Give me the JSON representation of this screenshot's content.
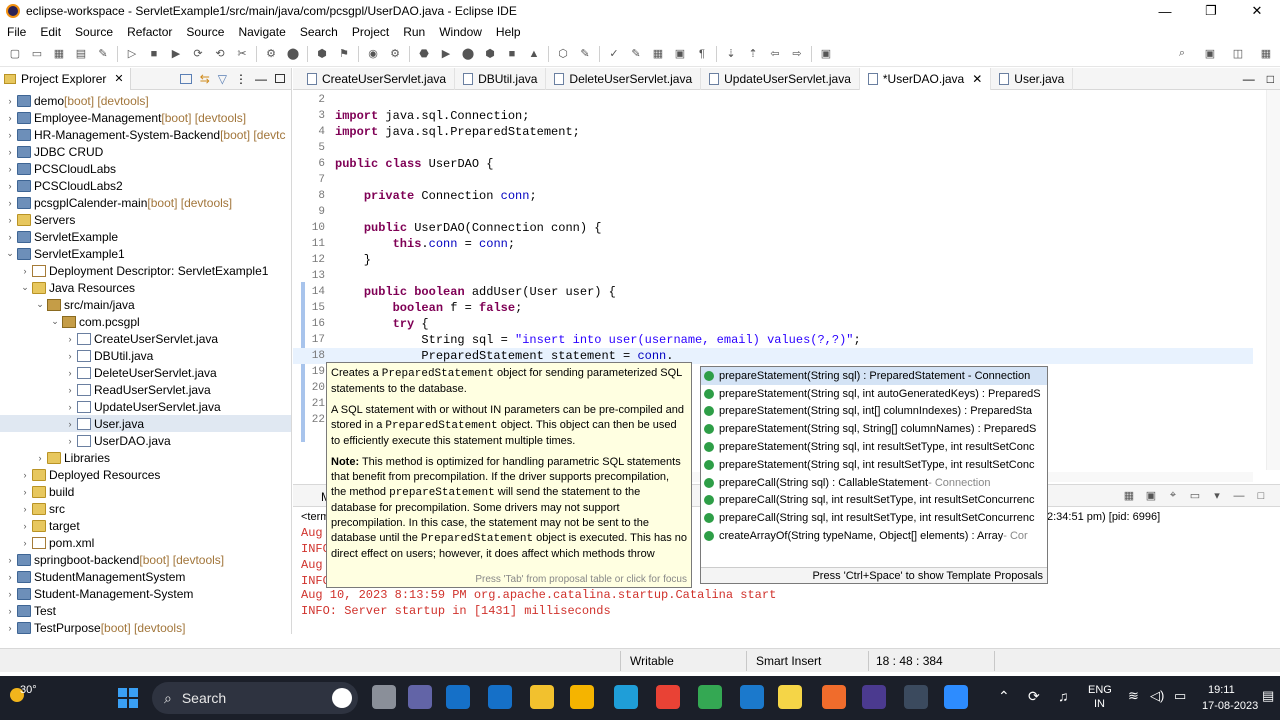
{
  "window": {
    "title": "eclipse-workspace - ServletExample1/src/main/java/com/pcsgpl/UserDAO.java - Eclipse IDE",
    "minimize": "—",
    "maximize": "❐",
    "close": "✕"
  },
  "menu": [
    "File",
    "Edit",
    "Source",
    "Refactor",
    "Source",
    "Navigate",
    "Search",
    "Project",
    "Run",
    "Window",
    "Help"
  ],
  "explorer": {
    "title": "Project Explorer",
    "items": [
      {
        "label": "demo",
        "dec": " [boot] [devtools]",
        "indent": 0,
        "icon": "proj"
      },
      {
        "label": "Employee-Management",
        "dec": " [boot] [devtools]",
        "indent": 0,
        "icon": "proj"
      },
      {
        "label": "HR-Management-System-Backend",
        "dec": " [boot] [devtc",
        "indent": 0,
        "icon": "proj"
      },
      {
        "label": "JDBC CRUD",
        "dec": "",
        "indent": 0,
        "icon": "proj"
      },
      {
        "label": "PCSCloudLabs",
        "dec": "",
        "indent": 0,
        "icon": "proj"
      },
      {
        "label": "PCSCloudLabs2",
        "dec": "",
        "indent": 0,
        "icon": "proj"
      },
      {
        "label": "pcsgplCalender-main",
        "dec": " [boot] [devtools]",
        "indent": 0,
        "icon": "proj"
      },
      {
        "label": "Servers",
        "dec": "",
        "indent": 0,
        "icon": "fold"
      },
      {
        "label": "ServletExample",
        "dec": "",
        "indent": 0,
        "icon": "proj"
      },
      {
        "label": "ServletExample1",
        "dec": "",
        "indent": 0,
        "icon": "proj",
        "open": true
      },
      {
        "label": "Deployment Descriptor: ServletExample1",
        "dec": "",
        "indent": 1,
        "icon": "xmlf"
      },
      {
        "label": "Java Resources",
        "dec": "",
        "indent": 1,
        "icon": "fold",
        "open": true
      },
      {
        "label": "src/main/java",
        "dec": "",
        "indent": 2,
        "icon": "pkg",
        "open": true
      },
      {
        "label": "com.pcsgpl",
        "dec": "",
        "indent": 3,
        "icon": "pkg",
        "open": true
      },
      {
        "label": "CreateUserServlet.java",
        "dec": "",
        "indent": 4,
        "icon": "javaf"
      },
      {
        "label": "DBUtil.java",
        "dec": "",
        "indent": 4,
        "icon": "javaf"
      },
      {
        "label": "DeleteUserServlet.java",
        "dec": "",
        "indent": 4,
        "icon": "javaf"
      },
      {
        "label": "ReadUserServlet.java",
        "dec": "",
        "indent": 4,
        "icon": "javaf"
      },
      {
        "label": "UpdateUserServlet.java",
        "dec": "",
        "indent": 4,
        "icon": "javaf"
      },
      {
        "label": "User.java",
        "dec": "",
        "indent": 4,
        "icon": "javaf",
        "selected": true
      },
      {
        "label": "UserDAO.java",
        "dec": "",
        "indent": 4,
        "icon": "javaf"
      },
      {
        "label": "Libraries",
        "dec": "",
        "indent": 2,
        "icon": "fold"
      },
      {
        "label": "Deployed Resources",
        "dec": "",
        "indent": 1,
        "icon": "fold"
      },
      {
        "label": "build",
        "dec": "",
        "indent": 1,
        "icon": "fold"
      },
      {
        "label": "src",
        "dec": "",
        "indent": 1,
        "icon": "fold"
      },
      {
        "label": "target",
        "dec": "",
        "indent": 1,
        "icon": "fold"
      },
      {
        "label": "pom.xml",
        "dec": "",
        "indent": 1,
        "icon": "xmlf"
      },
      {
        "label": "springboot-backend",
        "dec": " [boot] [devtools]",
        "indent": 0,
        "icon": "proj"
      },
      {
        "label": "StudentManagementSystem",
        "dec": "",
        "indent": 0,
        "icon": "proj"
      },
      {
        "label": "Student-Management-System",
        "dec": "",
        "indent": 0,
        "icon": "proj"
      },
      {
        "label": "Test",
        "dec": "",
        "indent": 0,
        "icon": "proj"
      },
      {
        "label": "TestPurpose",
        "dec": " [boot] [devtools]",
        "indent": 0,
        "icon": "proj"
      }
    ]
  },
  "editor_tabs": [
    {
      "label": "CreateUserServlet.java",
      "active": false
    },
    {
      "label": "DBUtil.java",
      "active": false
    },
    {
      "label": "DeleteUserServlet.java",
      "active": false
    },
    {
      "label": "UpdateUserServlet.java",
      "active": false
    },
    {
      "label": "*UserDAO.java",
      "active": true
    },
    {
      "label": "User.java",
      "active": false
    }
  ],
  "code_lines": [
    {
      "n": "2",
      "t": ""
    },
    {
      "n": "3",
      "t": "import java.sql.Connection;"
    },
    {
      "n": "4",
      "t": "import java.sql.PreparedStatement;"
    },
    {
      "n": "5",
      "t": ""
    },
    {
      "n": "6",
      "t": "public class UserDAO {"
    },
    {
      "n": "7",
      "t": ""
    },
    {
      "n": "8",
      "t": "    private Connection conn;"
    },
    {
      "n": "9",
      "t": ""
    },
    {
      "n": "10",
      "t": "    public UserDAO(Connection conn) {"
    },
    {
      "n": "11",
      "t": "        this.conn = conn;"
    },
    {
      "n": "12",
      "t": "    }"
    },
    {
      "n": "13",
      "t": ""
    },
    {
      "n": "14",
      "t": "    public boolean addUser(User user) {"
    },
    {
      "n": "15",
      "t": "        boolean f = false;"
    },
    {
      "n": "16",
      "t": "        try {"
    },
    {
      "n": "17",
      "t": "            String sql = \"insert into user(username, email) values(?,?)\";"
    },
    {
      "n": "18",
      "t": "            PreparedStatement statement = conn."
    },
    {
      "n": "19",
      "t": ""
    },
    {
      "n": "20",
      "t": ""
    },
    {
      "n": "21",
      "t": ""
    },
    {
      "n": "22",
      "t": ""
    }
  ],
  "tooltip": {
    "p1a": "Creates a ",
    "p1code": "PreparedStatement",
    "p1b": " object for sending parameterized SQL statements to the database.",
    "p2a": "A SQL statement with or without IN parameters can be pre-compiled and stored in a ",
    "p2code": "PreparedStatement",
    "p2b": " object. This object can then be used to efficiently execute this statement multiple times.",
    "note_label": "Note:",
    "p3a": " This method is optimized for handling parametric SQL statements that benefit from precompilation. If the driver supports precompilation, the method ",
    "p3code": "prepareStatement",
    "p3b": " will send the statement to the database for precompilation. Some drivers may not support precompilation. In this case, the statement may not be sent to the database until the ",
    "p3code2": "PreparedStatement",
    "p3c": " object is executed. This has no direct effect on users; however, it does affect which methods throw",
    "hint": "Press 'Tab' from proposal table or click for focus"
  },
  "proposals": {
    "items": [
      {
        "text": "prepareStatement(String sql) : PreparedStatement - Connection",
        "grey": ""
      },
      {
        "text": "prepareStatement(String sql, int autoGeneratedKeys) : PreparedS",
        "grey": ""
      },
      {
        "text": "prepareStatement(String sql, int[] columnIndexes) : PreparedSta",
        "grey": ""
      },
      {
        "text": "prepareStatement(String sql, String[] columnNames) : PreparedS",
        "grey": ""
      },
      {
        "text": "prepareStatement(String sql, int resultSetType, int resultSetConc",
        "grey": ""
      },
      {
        "text": "prepareStatement(String sql, int resultSetType, int resultSetConc",
        "grey": ""
      },
      {
        "text": "prepareCall(String sql) : CallableStatement",
        "grey": " - Connection"
      },
      {
        "text": "prepareCall(String sql, int resultSetType, int resultSetConcurrenc",
        "grey": ""
      },
      {
        "text": "prepareCall(String sql, int resultSetType, int resultSetConcurrenc",
        "grey": ""
      },
      {
        "text": "createArrayOf(String typeName, Object[] elements) : Array",
        "grey": " - Cor"
      }
    ],
    "footer": "Press 'Ctrl+Space' to show Template Proposals"
  },
  "console": {
    "tab_label": "M",
    "path_prefix": "<term",
    "pid": "2:34:51 pm) [pid: 6996]",
    "partial_lines": [
      "Aug",
      "INFO",
      "Aug",
      "INFO"
    ],
    "line1": "Aug 10, 2023 8:13:59 PM org.apache.catalina.startup.Catalina start",
    "line2": "INFO: Server startup in [1431] milliseconds"
  },
  "status": {
    "writable": "Writable",
    "insert": "Smart Insert",
    "position": "18 : 48 : 384"
  },
  "taskbar": {
    "temp": "30°",
    "search": "Search",
    "lang1": "ENG",
    "lang2": "IN",
    "time": "19:11",
    "date": "17-08-2023"
  }
}
